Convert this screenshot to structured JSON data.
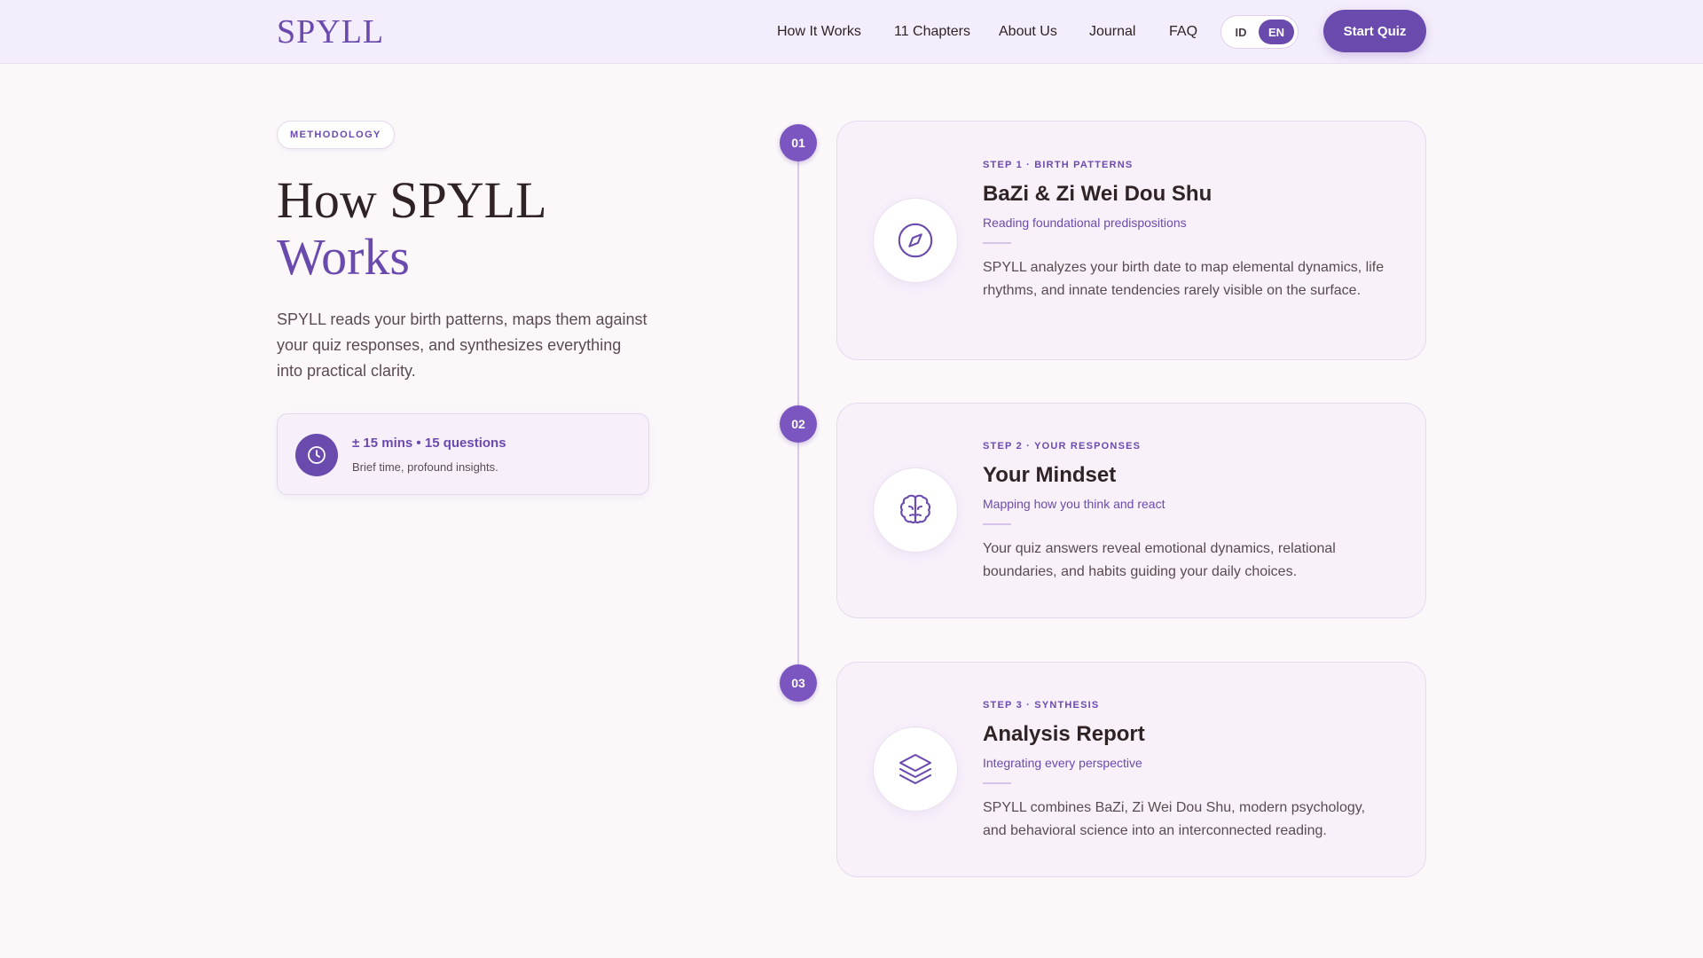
{
  "header": {
    "logo": "SPYLL",
    "nav": [
      "How It Works",
      "11 Chapters",
      "About Us",
      "Journal",
      "FAQ"
    ],
    "lang": {
      "id": "ID",
      "en": "EN",
      "active": "EN"
    },
    "cta": "Start Quiz"
  },
  "hero": {
    "badge": "METHODOLOGY",
    "title_line1": "How SPYLL",
    "title_line2": "Works",
    "description": "SPYLL reads your birth patterns, maps them against your quiz responses, and synthesizes everything into practical clarity.",
    "info": {
      "main": "± 15 mins • 15 questions",
      "sub": "Brief time, profound insights.",
      "icon": "clock-icon"
    }
  },
  "steps": [
    {
      "number": "01",
      "label": "STEP 1 · BIRTH PATTERNS",
      "title": "BaZi & Zi Wei Dou Shu",
      "subtitle": "Reading foundational predispositions",
      "description": "SPYLL analyzes your birth date to map elemental dynamics, life rhythms, and innate tendencies rarely visible on the surface.",
      "icon": "compass-icon"
    },
    {
      "number": "02",
      "label": "STEP 2 · YOUR RESPONSES",
      "title": "Your Mindset",
      "subtitle": "Mapping how you think and react",
      "description": "Your quiz answers reveal emotional dynamics, relational boundaries, and habits guiding your daily choices.",
      "icon": "brain-icon"
    },
    {
      "number": "03",
      "label": "STEP 3 · SYNTHESIS",
      "title": "Analysis Report",
      "subtitle": "Integrating every perspective",
      "description": "SPYLL combines BaZi, Zi Wei Dou Shu, modern psychology, and behavioral science into an interconnected reading.",
      "icon": "layers-icon"
    }
  ],
  "colors": {
    "accent": "#6b4aae",
    "header_bg": "#f4edfb",
    "page_bg": "#fcf8fa",
    "card_bg": "#f8f1fa"
  }
}
